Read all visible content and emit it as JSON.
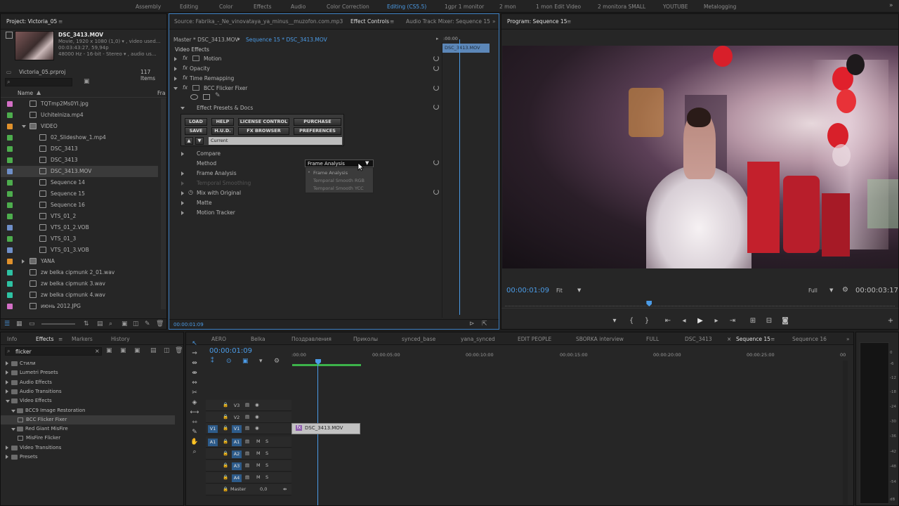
{
  "workspaces": {
    "items": [
      "Assembly",
      "Editing",
      "Color",
      "Effects",
      "Audio",
      "Color Correction",
      "Editing (CS5.5)",
      "1gpr 1 monitor",
      "2 mon",
      "1 mon Edit Video",
      "2 monitora SMALL",
      "YOUTUBE",
      "Metalogging"
    ],
    "active": "Editing (CS5.5)"
  },
  "project": {
    "title": "Project: Victoria_05",
    "clip_name": "DSC_3413.MOV",
    "clip_info_1": "Movie, 1920 x 1080 (1,0) ▾ , video used...",
    "clip_info_2": "00:03:43:27, 59,94p",
    "clip_info_3": "48000 Hz - 16-bit - Stereo ▾ , audio us...",
    "file": "Victoria_05.prproj",
    "count": "117 Items",
    "col_name": "Name",
    "col_fr": "Fra",
    "items": [
      {
        "label": "TQTmp2Ms0YI.jpg",
        "color": "#d36fc6",
        "icon": "image-icon"
      },
      {
        "label": "Uchitelniza.mp4",
        "color": "#4dad4d",
        "icon": "clip-icon"
      },
      {
        "label": "VIDEO",
        "color": "#e0912c",
        "icon": "folder-icon"
      },
      {
        "label": "02_Slideshow_1.mp4",
        "color": "#4dad4d",
        "icon": "clip-icon"
      },
      {
        "label": "DSC_3413",
        "color": "#4dad4d",
        "icon": "sequence-icon"
      },
      {
        "label": "DSC_3413",
        "color": "#4dad4d",
        "icon": "sequence-icon"
      },
      {
        "label": "DSC_3413.MOV",
        "color": "#6f8fc8",
        "icon": "clip-icon"
      },
      {
        "label": "Sequence 14",
        "color": "#4dad4d",
        "icon": "sequence-icon"
      },
      {
        "label": "Sequence 15",
        "color": "#4dad4d",
        "icon": "sequence-icon"
      },
      {
        "label": "Sequence 16",
        "color": "#4dad4d",
        "icon": "sequence-icon"
      },
      {
        "label": "VTS_01_2",
        "color": "#4dad4d",
        "icon": "sequence-icon"
      },
      {
        "label": "VTS_01_2.VOB",
        "color": "#6f8fc8",
        "icon": "clip-icon"
      },
      {
        "label": "VTS_01_3",
        "color": "#4dad4d",
        "icon": "sequence-icon"
      },
      {
        "label": "VTS_01_3.VOB",
        "color": "#6f8fc8",
        "icon": "clip-icon"
      },
      {
        "label": "YANA",
        "color": "#e0912c",
        "icon": "folder-icon"
      },
      {
        "label": "zw belka cipmunk 2_01.wav",
        "color": "#2ec2a3",
        "icon": "audio-icon"
      },
      {
        "label": "zw belka cipmunk 3.wav",
        "color": "#2ec2a3",
        "icon": "audio-icon"
      },
      {
        "label": "zw belka cipmunk 4.wav",
        "color": "#2ec2a3",
        "icon": "audio-icon"
      },
      {
        "label": "июнь 2012.JPG",
        "color": "#d36fc6",
        "icon": "image-icon"
      }
    ]
  },
  "source_tabs": {
    "source": "Source: Fabrika_-_Ne_vinovataya_ya_minus__muzofon.com.mp3",
    "effect_controls": "Effect Controls",
    "audio_mixer": "Audio Track Mixer: Sequence 15"
  },
  "effect_controls": {
    "master": "Master * DSC_3413.MOV",
    "sequence": "Sequence 15 * DSC_3413.MOV",
    "time_start": ":00:00",
    "clip_bar": "DSC_3413.MOV",
    "video_effects": "Video Effects",
    "effects": [
      "Motion",
      "Opacity",
      "Time Remapping",
      "BCC Flicker Fixer"
    ],
    "presets_header": "Effect Presets & Docs",
    "bcc_buttons": {
      "load": "LOAD",
      "help": "HELP",
      "license": "LICENSE CONTROL",
      "purchase": "PURCHASE",
      "save": "SAVE",
      "hud": "H.U.D.",
      "fx_browser": "FX BROWSER",
      "preferences": "PREFERENCES"
    },
    "preset_value": "Current",
    "params": [
      "Compare",
      "Method",
      "Frame Analysis",
      "Temporal Smoothing",
      "Mix with Original",
      "Matte",
      "Motion Tracker"
    ],
    "method_value": "Frame Analysis",
    "dropdown_options": [
      "Frame Analysis",
      "Temporal Smooth RGB",
      "Temporal Smooth YCC"
    ],
    "dropdown_selected": "Frame Analysis",
    "footer_time": "00:00:01:09"
  },
  "program": {
    "title": "Program: Sequence 15",
    "timecode": "00:00:01:09",
    "fit": "Fit",
    "quality": "Full",
    "duration": "00:00:03:17",
    "playhead_fraction": 0.37
  },
  "effects_panel": {
    "tabs": [
      "Info",
      "Effects",
      "Markers",
      "History"
    ],
    "active_tab": "Effects",
    "search": "flicker",
    "items": [
      {
        "label": "Стили",
        "indent": 0,
        "open": false
      },
      {
        "label": "Lumetri Presets",
        "indent": 0,
        "open": false
      },
      {
        "label": "Audio Effects",
        "indent": 0,
        "open": false
      },
      {
        "label": "Audio Transitions",
        "indent": 0,
        "open": false
      },
      {
        "label": "Video Effects",
        "indent": 0,
        "open": true
      },
      {
        "label": "BCC9 Image Restoration",
        "indent": 1,
        "open": true
      },
      {
        "label": "BCC Flicker Fixer",
        "indent": 2,
        "leaf": true
      },
      {
        "label": "Red Giant MisFire",
        "indent": 1,
        "open": true
      },
      {
        "label": "MisFire Flicker",
        "indent": 2,
        "leaf": true
      },
      {
        "label": "Video Transitions",
        "indent": 0,
        "open": false
      },
      {
        "label": "Presets",
        "indent": 0,
        "open": false
      }
    ]
  },
  "timeline": {
    "tabs": [
      "AERO",
      "Belka",
      "Поздравления",
      "Приколы",
      "synced_base",
      "yana_synced",
      "EDIT PEOPLE",
      "SBORKA interview",
      "FULL",
      "DSC_3413",
      "Sequence 15",
      "Sequence 16"
    ],
    "active_tab": "Sequence 15",
    "timecode": "00:00:01:09",
    "ruler": [
      ":00:00",
      "00:00:05:00",
      "00:00:10:00",
      "00:00:15:00",
      "00:00:20:00",
      "00:00:25:00",
      "00"
    ],
    "tracks": [
      {
        "label": "V3",
        "type": "video"
      },
      {
        "label": "V2",
        "type": "video"
      },
      {
        "label": "V1",
        "type": "video",
        "source": "V1"
      },
      {
        "label": "A1",
        "type": "audio",
        "source": "A1"
      },
      {
        "label": "A2",
        "type": "audio"
      },
      {
        "label": "A3",
        "type": "audio"
      },
      {
        "label": "A4",
        "type": "audio"
      }
    ],
    "master_label": "Master",
    "master_value": "0,0",
    "mute": "M",
    "solo": "S",
    "clip": "DSC_3413.MOV"
  },
  "meter": {
    "scale": [
      "0",
      "-6",
      "-12",
      "-18",
      "-24",
      "-30",
      "-36",
      "-42",
      "-48",
      "-54",
      "dB"
    ]
  },
  "colors": {
    "accent": "#4b9be6",
    "panel": "#262626",
    "track_active": "#2d5b8a"
  }
}
